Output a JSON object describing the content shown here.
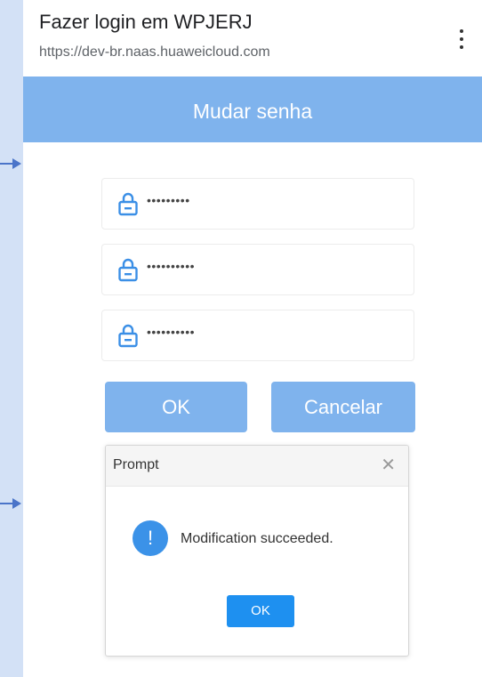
{
  "browser": {
    "title": "Fazer login em WPJERJ",
    "url": "https://dev-br.naas.huaweicloud.com",
    "menu_icon": "more-vertical-icon"
  },
  "page": {
    "header_title": "Mudar senha",
    "fields": [
      {
        "icon": "lock-icon",
        "masked_value": "•••••••••"
      },
      {
        "icon": "lock-icon",
        "masked_value": "••••••••••"
      },
      {
        "icon": "lock-icon",
        "masked_value": "••••••••••"
      }
    ],
    "ok_label": "OK",
    "cancel_label": "Cancelar"
  },
  "dialog": {
    "title": "Prompt",
    "close_icon": "close-icon",
    "info_icon_glyph": "!",
    "message": "Modification succeeded.",
    "ok_label": "OK"
  },
  "colors": {
    "accent": "#7fb3ed",
    "dialog_button": "#1e90f0",
    "info_icon": "#3b92e8",
    "background": "#d3e1f6",
    "annotation_arrow": "#4a74c9"
  }
}
